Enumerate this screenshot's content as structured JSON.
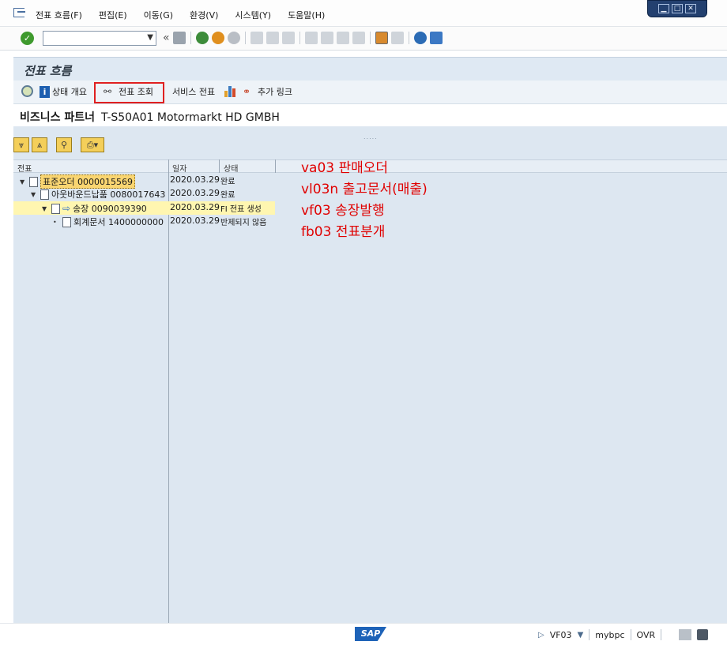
{
  "menubar": {
    "items": [
      "전표 흐름(F)",
      "편집(E)",
      "이동(G)",
      "환경(V)",
      "시스템(Y)",
      "도움말(H)"
    ]
  },
  "window_controls": [
    "▁",
    "□",
    "✕"
  ],
  "toolbar": {
    "command_field_value": "",
    "back_glyph": "«"
  },
  "title": "전표 흐름",
  "app_toolbar": {
    "status_overview": "상태 개요",
    "display_document": "전표 조회",
    "service_document": "서비스 전표",
    "additional_links": "추가 링크"
  },
  "partner": {
    "label": "비즈니스 파트너",
    "value": "T-S50A01 Motormarkt HD GMBH"
  },
  "tree": {
    "headers": {
      "document": "전표",
      "date": "일자",
      "status": "상태"
    },
    "rows": [
      {
        "label": "표준오더 0000015569",
        "date": "2020.03.29",
        "status": "완료"
      },
      {
        "label": "아웃바운드납품 0080017643",
        "date": "2020.03.29",
        "status": "완료"
      },
      {
        "label": "송장 0090039390",
        "date": "2020.03.29",
        "status": "FI 전표 생성"
      },
      {
        "label": "회계문서 1400000000",
        "date": "2020.03.29",
        "status": "반제되지 않음"
      }
    ]
  },
  "annotations": [
    "va03 판매오더",
    "vl03n 출고문서(매출)",
    "vf03 송장발행",
    "fb03 전표분개"
  ],
  "statusbar": {
    "logo": "SAP",
    "transaction": "VF03",
    "server": "mybpc",
    "mode": "OVR"
  },
  "colors": {
    "highlight_border": "#e02020",
    "annotation_text": "#e00000",
    "content_background": "#dde7f1",
    "selected_row": "#fff6b0"
  }
}
